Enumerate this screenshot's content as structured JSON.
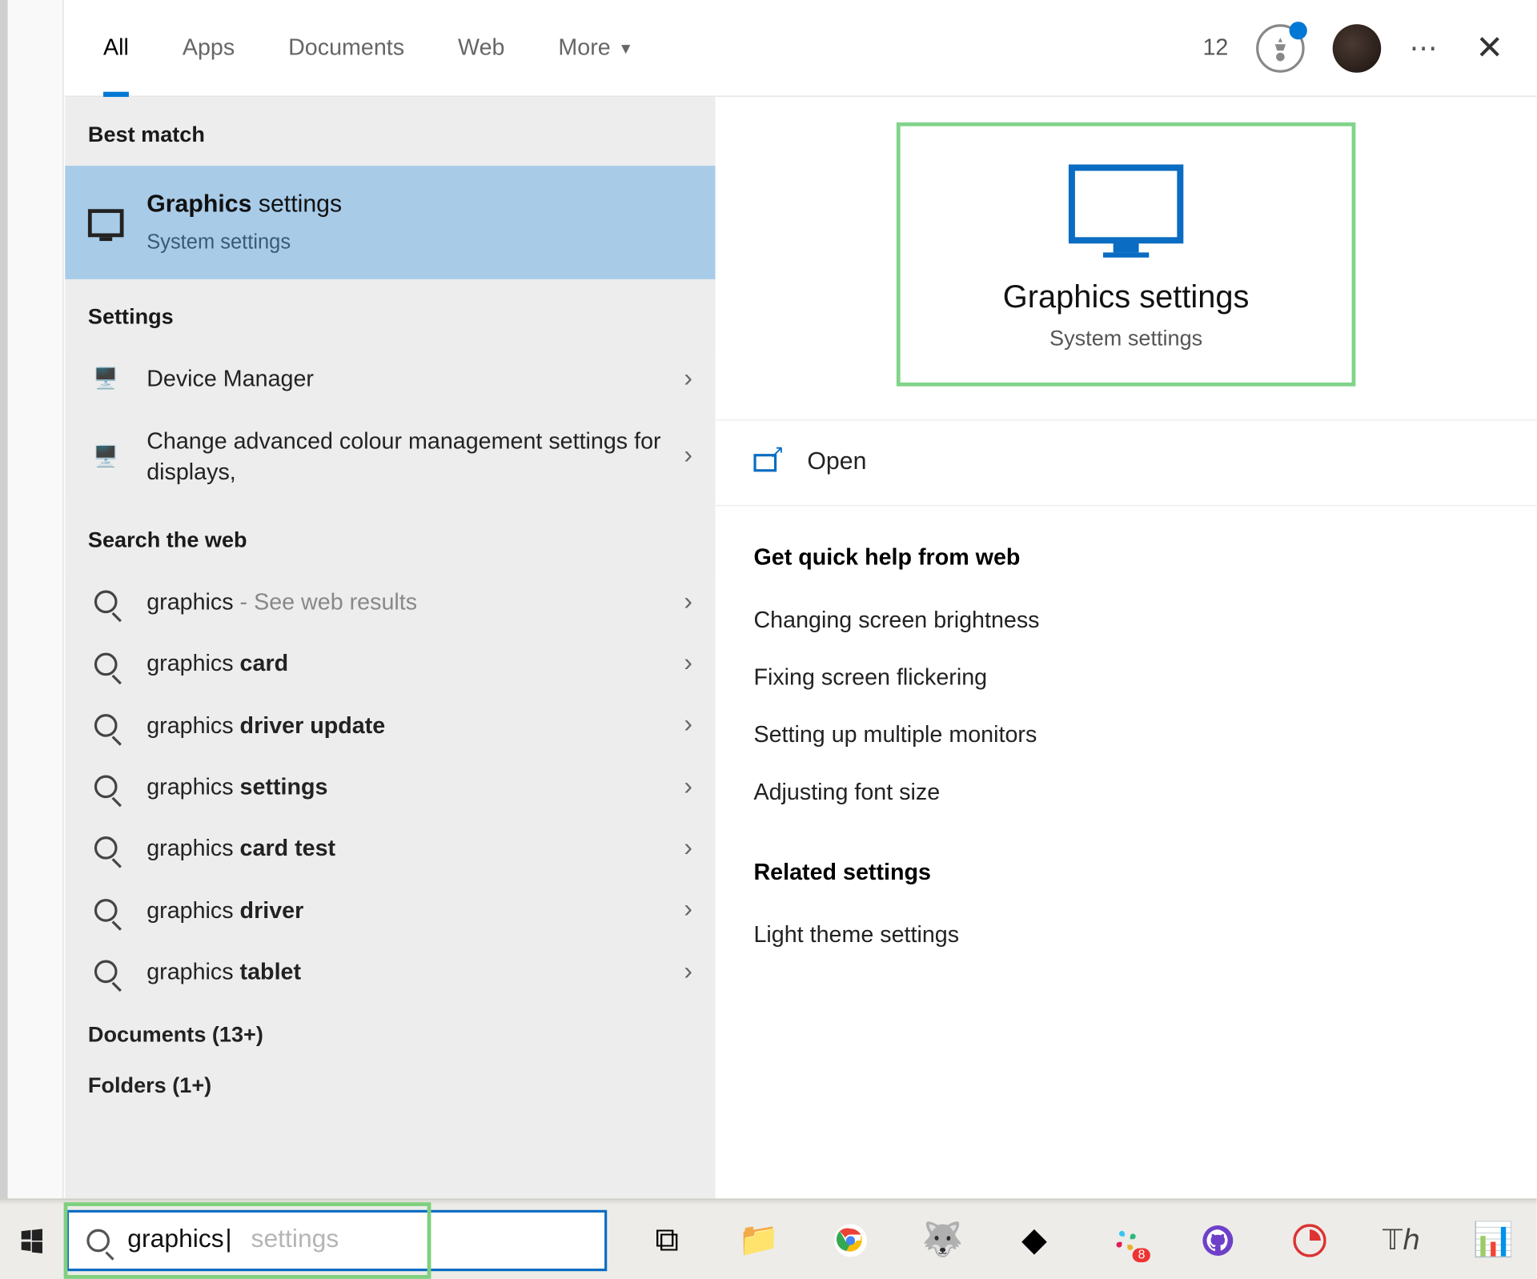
{
  "header": {
    "tabs": {
      "all": "All",
      "apps": "Apps",
      "documents": "Documents",
      "web": "Web",
      "more": "More"
    },
    "rewards_count": "12"
  },
  "left": {
    "best_match_header": "Best match",
    "best_match": {
      "title_prefix": "Graphics",
      "title_suffix": " settings",
      "subtitle": "System settings"
    },
    "settings_header": "Settings",
    "settings_items": {
      "device_manager": "Device Manager",
      "colour_mgmt": "Change advanced colour management settings for displays,"
    },
    "web_header": "Search the web",
    "web_items": [
      {
        "prefix": "graphics",
        "suffix": "",
        "tail": " - See web results"
      },
      {
        "prefix": "graphics ",
        "suffix": "card",
        "tail": ""
      },
      {
        "prefix": "graphics ",
        "suffix": "driver update",
        "tail": ""
      },
      {
        "prefix": "graphics ",
        "suffix": "settings",
        "tail": ""
      },
      {
        "prefix": "graphics ",
        "suffix": "card test",
        "tail": ""
      },
      {
        "prefix": "graphics ",
        "suffix": "driver",
        "tail": ""
      },
      {
        "prefix": "graphics ",
        "suffix": "tablet",
        "tail": ""
      }
    ],
    "documents_header": "Documents (13+)",
    "folders_header": "Folders (1+)"
  },
  "right": {
    "hero_title": "Graphics settings",
    "hero_sub": "System settings",
    "open_label": "Open",
    "help_header": "Get quick help from web",
    "help_items": {
      "brightness": "Changing screen brightness",
      "flicker": "Fixing screen flickering",
      "monitors": "Setting up multiple monitors",
      "font": "Adjusting font size"
    },
    "related_header": "Related settings",
    "related_items": {
      "light_theme": "Light theme settings"
    }
  },
  "searchbox": {
    "typed": "graphics",
    "ghost": " settings"
  }
}
